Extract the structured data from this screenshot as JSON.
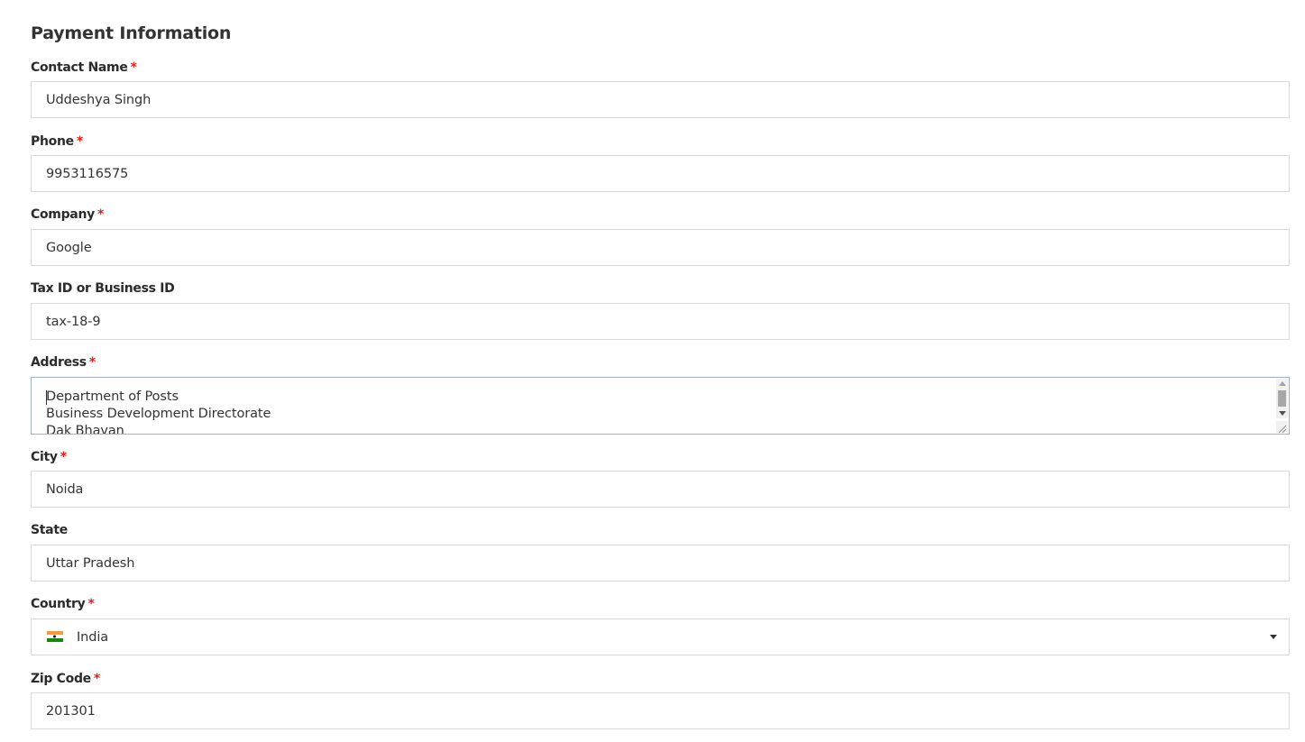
{
  "form": {
    "title": "Payment Information",
    "required_marker": "*",
    "contact_name": {
      "label": "Contact Name",
      "value": "Uddeshya Singh"
    },
    "phone": {
      "label": "Phone",
      "value": "9953116575"
    },
    "company": {
      "label": "Company",
      "value": "Google"
    },
    "tax_id": {
      "label": "Tax ID or Business ID",
      "value": "tax-18-9"
    },
    "address": {
      "label": "Address",
      "value": "Department of Posts\nBusiness Development Directorate\nDak Bhavan"
    },
    "city": {
      "label": "City",
      "value": "Noida"
    },
    "state": {
      "label": "State",
      "value": "Uttar Pradesh"
    },
    "country": {
      "label": "Country",
      "value": "India",
      "flag_icon": "india-flag-icon"
    },
    "zip_code": {
      "label": "Zip Code",
      "value": "201301"
    }
  },
  "colors": {
    "required": "#e0201b",
    "border": "#d9d9d9",
    "focus_border": "#9fb3c8",
    "text": "#333333"
  }
}
